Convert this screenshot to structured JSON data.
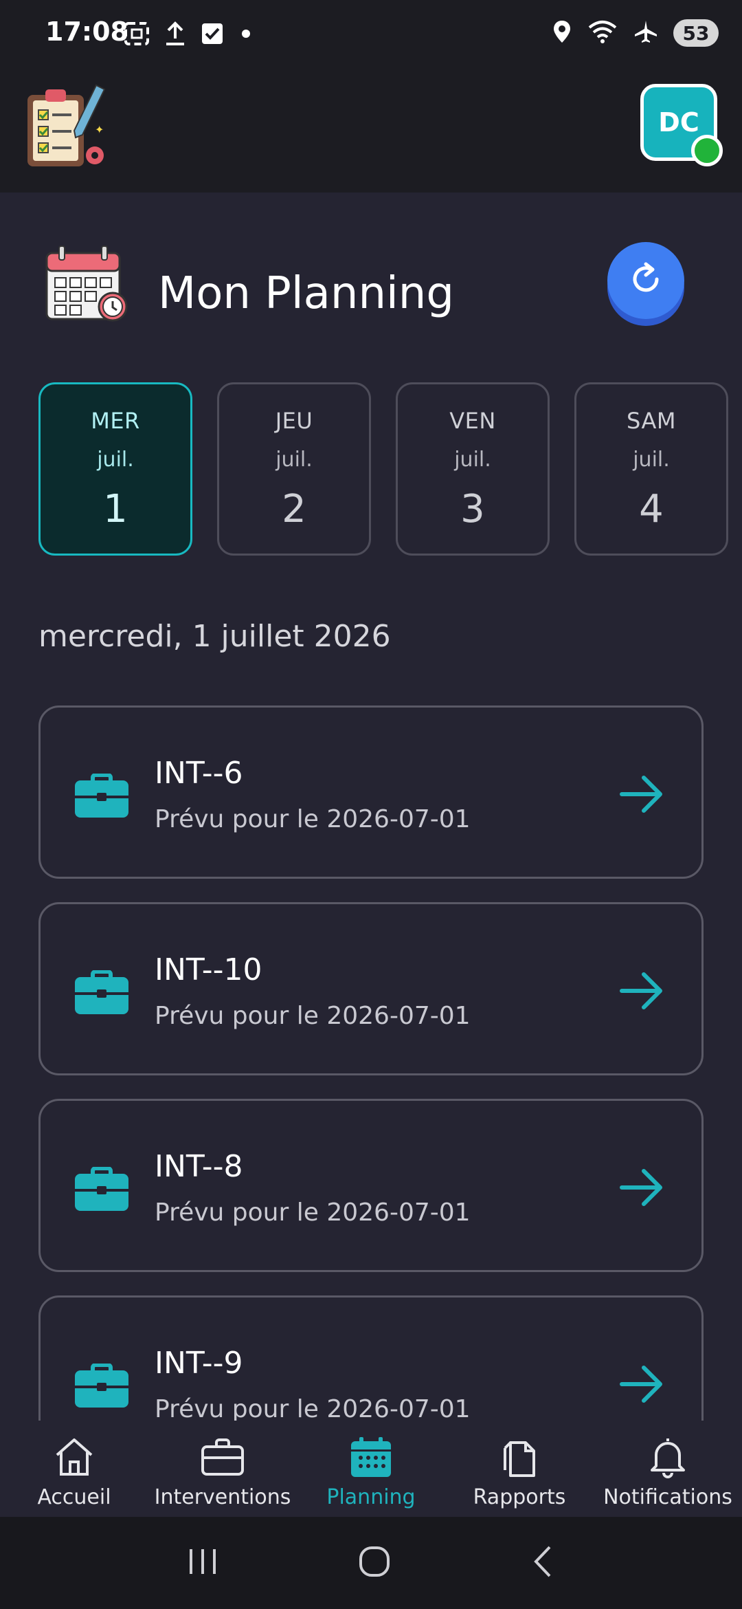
{
  "status_bar": {
    "time": "17:08",
    "battery": "53",
    "left_icons": [
      "screenshot-icon",
      "upload-icon",
      "checkbox-icon",
      "dot-icon"
    ],
    "right_icons": [
      "location-icon",
      "wifi-icon",
      "airplane-icon",
      "battery-icon"
    ]
  },
  "app_bar": {
    "logo": "clipboard-checklist-logo",
    "avatar_initials": "DC",
    "avatar_status_color": "#21b33a"
  },
  "page": {
    "title": "Mon Planning",
    "title_icon": "calendar-clock-icon",
    "refresh_icon": "refresh-icon"
  },
  "days": [
    {
      "name": "MER",
      "month": "juil.",
      "number": "1",
      "active": true
    },
    {
      "name": "JEU",
      "month": "juil.",
      "number": "2",
      "active": false
    },
    {
      "name": "VEN",
      "month": "juil.",
      "number": "3",
      "active": false
    },
    {
      "name": "SAM",
      "month": "juil.",
      "number": "4",
      "active": false
    }
  ],
  "date_heading": "mercredi, 1 juillet 2026",
  "interventions": [
    {
      "title": "INT--6",
      "subtitle": "Prévu pour le 2026-07-01"
    },
    {
      "title": "INT--10",
      "subtitle": "Prévu pour le 2026-07-01"
    },
    {
      "title": "INT--8",
      "subtitle": "Prévu pour le 2026-07-01"
    },
    {
      "title": "INT--9",
      "subtitle": "Prévu pour le 2026-07-01"
    }
  ],
  "bottom_nav": [
    {
      "label": "Accueil",
      "icon": "home-icon",
      "active": false
    },
    {
      "label": "Interventions",
      "icon": "briefcase-icon",
      "active": false
    },
    {
      "label": "Planning",
      "icon": "calendar-icon",
      "active": true
    },
    {
      "label": "Rapports",
      "icon": "documents-icon",
      "active": false
    },
    {
      "label": "Notifications",
      "icon": "bell-icon",
      "active": false
    }
  ],
  "colors": {
    "accent": "#1fb3bd",
    "refresh": "#3f7ef2",
    "background": "#252432"
  }
}
